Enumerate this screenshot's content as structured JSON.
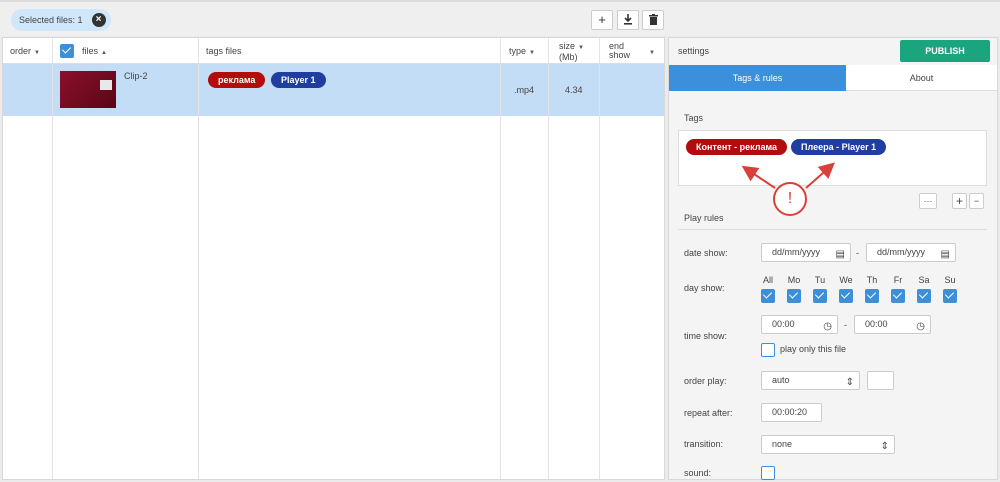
{
  "toolbar": {
    "selected_chip": "Selected files: 1",
    "add_icon": "plus-icon",
    "download_icon": "download-icon",
    "delete_icon": "trash-icon"
  },
  "table": {
    "headers": {
      "order": "order",
      "files": "files",
      "tags": "tags files",
      "type": "type",
      "size_line1": "size",
      "size_line2": "(Mb)",
      "end_line1": "end",
      "end_line2": "show"
    },
    "rows": [
      {
        "name": "Clip-2",
        "tags": [
          "реклама",
          "Player 1"
        ],
        "type": ".mp4",
        "size": "4.34",
        "selected": true
      }
    ]
  },
  "settings": {
    "title": "settings",
    "publish": "PUBLISH",
    "tabs": [
      "Tags & rules",
      "About"
    ],
    "tags_label": "Tags",
    "tags": [
      "Контент - реклама",
      "Плеера - Player 1"
    ],
    "more_btn": "···",
    "plus_btn": "+",
    "minus_btn": "−",
    "alert": "!",
    "play_rules_label": "Play rules",
    "date_show_label": "date show:",
    "date_from_placeholder": "dd/mm/yyyy",
    "date_to_placeholder": "dd/mm/yyyy",
    "date_dash": "-",
    "day_show_label": "day show:",
    "days": [
      "All",
      "Mo",
      "Tu",
      "We",
      "Th",
      "Fr",
      "Sa",
      "Su"
    ],
    "time_show_label": "time show:",
    "time_from": "00:00",
    "time_to": "00:00",
    "time_dash": "-",
    "play_only_label": "play only this file",
    "order_play_label": "order play:",
    "order_play_value": "auto",
    "repeat_after_label": "repeat after:",
    "repeat_after_value": "00:00:20",
    "transition_label": "transition:",
    "transition_value": "none",
    "sound_label": "sound:"
  },
  "colors": {
    "accent_blue": "#3b8fdb",
    "publish_green": "#1aa57f",
    "tag_red": "#b20c0c",
    "tag_blue": "#1f3ea0",
    "row_selected": "#c3ddf6",
    "alert_red": "#d9403a"
  }
}
